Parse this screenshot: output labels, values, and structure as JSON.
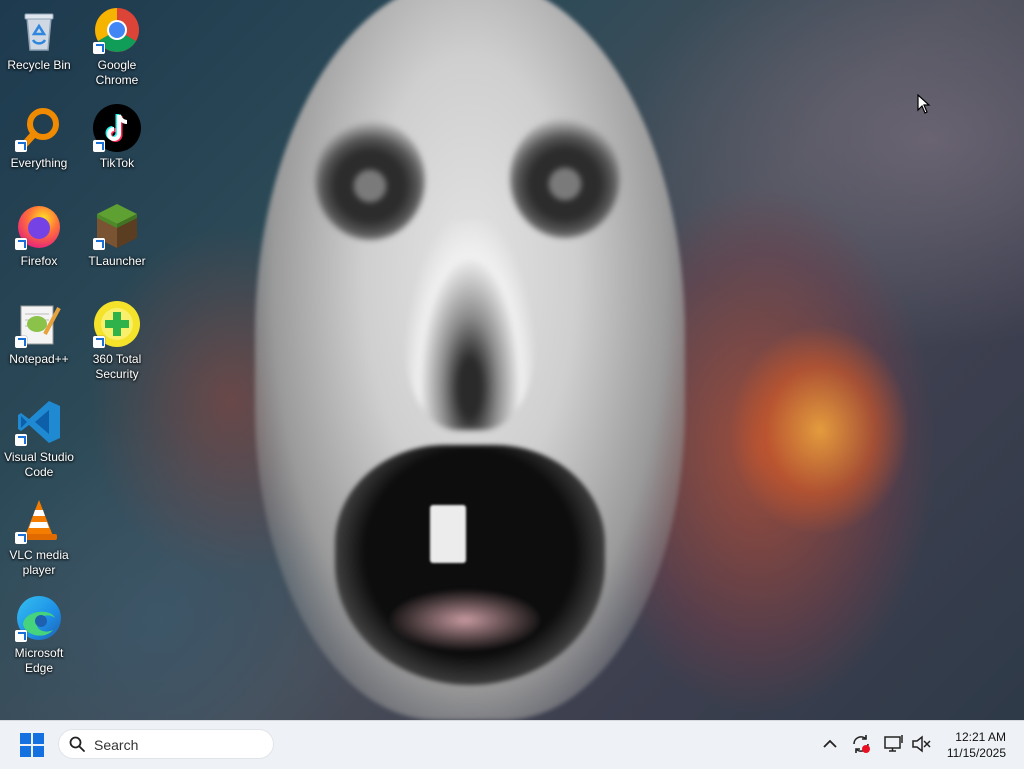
{
  "desktop": {
    "icons": [
      {
        "label": "Recycle Bin",
        "icon": "recycle-bin-icon"
      },
      {
        "label": "Google Chrome",
        "icon": "chrome-icon"
      },
      {
        "label": "Everything",
        "icon": "everything-search-icon"
      },
      {
        "label": "TikTok",
        "icon": "tiktok-icon"
      },
      {
        "label": "Firefox",
        "icon": "firefox-icon"
      },
      {
        "label": "TLauncher",
        "icon": "tlauncher-icon"
      },
      {
        "label": "Notepad++",
        "icon": "notepadpp-icon"
      },
      {
        "label": "360 Total Security",
        "icon": "360-security-icon"
      },
      {
        "label": "Visual Studio Code",
        "icon": "vscode-icon"
      },
      {
        "label": "VLC media player",
        "icon": "vlc-icon"
      },
      {
        "label": "Microsoft Edge",
        "icon": "edge-icon"
      }
    ]
  },
  "taskbar": {
    "search_placeholder": "Search",
    "clock_time": "12:21 AM",
    "clock_date": "11/15/2025"
  },
  "colors": {
    "accent": "#1570e0",
    "taskbar_bg": "#eef1f5"
  }
}
